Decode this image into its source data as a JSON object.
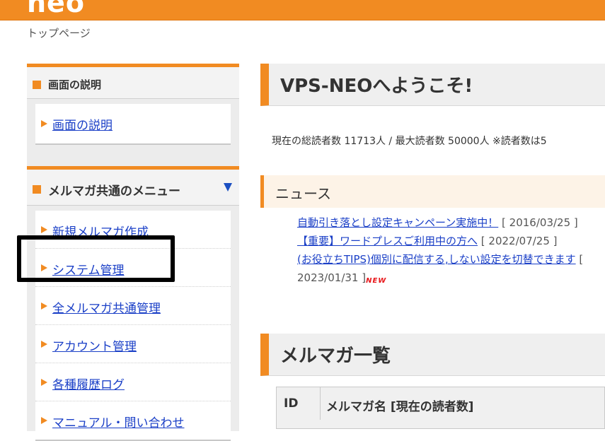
{
  "header": {
    "logo": "neo",
    "breadcrumb": "トップページ"
  },
  "sidebar": {
    "section1": {
      "title": "画面の説明",
      "items": [
        {
          "label": "画面の説明"
        }
      ]
    },
    "section2": {
      "title": "メルマガ共通のメニュー",
      "items": [
        {
          "label": "新規メルマガ作成"
        },
        {
          "label": "システム管理"
        },
        {
          "label": "全メルマガ共通管理"
        },
        {
          "label": "アカウント管理"
        },
        {
          "label": "各種履歴ログ"
        },
        {
          "label": "マニュアル・問い合わせ"
        }
      ]
    }
  },
  "main": {
    "welcome_title": "VPS-NEOへようこそ!",
    "stats": "現在の総読者数 11713人 / 最大読者数 50000人 ※読者数は5",
    "news": {
      "title": "ニュース",
      "items": [
        {
          "link": "自動引き落とし設定キャンペーン実施中！",
          "date": "[ 2016/03/25 ]",
          "is_new": false
        },
        {
          "link": "【重要】ワードプレスご利用中の方へ",
          "date": "[ 2022/07/25 ]",
          "is_new": false
        },
        {
          "link": "(お役立ちTIPS)個別に配信する,しない設定を切替できます",
          "date": "[ 2023/01/31 ]",
          "is_new": true,
          "badge": "NEW"
        }
      ]
    },
    "list": {
      "title": "メルマガ一覧",
      "columns": [
        "ID",
        "メルマガ名 [現在の読者数]"
      ]
    }
  },
  "colors": {
    "accent": "#f18b22",
    "link": "#1a3fc7",
    "highlight": "#000000"
  }
}
